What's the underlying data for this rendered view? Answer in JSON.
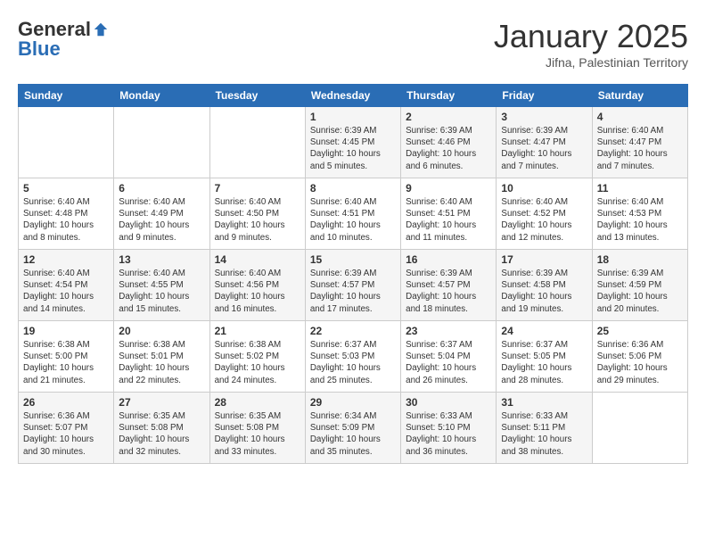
{
  "header": {
    "logo_general": "General",
    "logo_blue": "Blue",
    "month_title": "January 2025",
    "subtitle": "Jifna, Palestinian Territory"
  },
  "weekdays": [
    "Sunday",
    "Monday",
    "Tuesday",
    "Wednesday",
    "Thursday",
    "Friday",
    "Saturday"
  ],
  "weeks": [
    [
      {
        "day": "",
        "info": ""
      },
      {
        "day": "",
        "info": ""
      },
      {
        "day": "",
        "info": ""
      },
      {
        "day": "1",
        "info": "Sunrise: 6:39 AM\nSunset: 4:45 PM\nDaylight: 10 hours\nand 5 minutes."
      },
      {
        "day": "2",
        "info": "Sunrise: 6:39 AM\nSunset: 4:46 PM\nDaylight: 10 hours\nand 6 minutes."
      },
      {
        "day": "3",
        "info": "Sunrise: 6:39 AM\nSunset: 4:47 PM\nDaylight: 10 hours\nand 7 minutes."
      },
      {
        "day": "4",
        "info": "Sunrise: 6:40 AM\nSunset: 4:47 PM\nDaylight: 10 hours\nand 7 minutes."
      }
    ],
    [
      {
        "day": "5",
        "info": "Sunrise: 6:40 AM\nSunset: 4:48 PM\nDaylight: 10 hours\nand 8 minutes."
      },
      {
        "day": "6",
        "info": "Sunrise: 6:40 AM\nSunset: 4:49 PM\nDaylight: 10 hours\nand 9 minutes."
      },
      {
        "day": "7",
        "info": "Sunrise: 6:40 AM\nSunset: 4:50 PM\nDaylight: 10 hours\nand 9 minutes."
      },
      {
        "day": "8",
        "info": "Sunrise: 6:40 AM\nSunset: 4:51 PM\nDaylight: 10 hours\nand 10 minutes."
      },
      {
        "day": "9",
        "info": "Sunrise: 6:40 AM\nSunset: 4:51 PM\nDaylight: 10 hours\nand 11 minutes."
      },
      {
        "day": "10",
        "info": "Sunrise: 6:40 AM\nSunset: 4:52 PM\nDaylight: 10 hours\nand 12 minutes."
      },
      {
        "day": "11",
        "info": "Sunrise: 6:40 AM\nSunset: 4:53 PM\nDaylight: 10 hours\nand 13 minutes."
      }
    ],
    [
      {
        "day": "12",
        "info": "Sunrise: 6:40 AM\nSunset: 4:54 PM\nDaylight: 10 hours\nand 14 minutes."
      },
      {
        "day": "13",
        "info": "Sunrise: 6:40 AM\nSunset: 4:55 PM\nDaylight: 10 hours\nand 15 minutes."
      },
      {
        "day": "14",
        "info": "Sunrise: 6:40 AM\nSunset: 4:56 PM\nDaylight: 10 hours\nand 16 minutes."
      },
      {
        "day": "15",
        "info": "Sunrise: 6:39 AM\nSunset: 4:57 PM\nDaylight: 10 hours\nand 17 minutes."
      },
      {
        "day": "16",
        "info": "Sunrise: 6:39 AM\nSunset: 4:57 PM\nDaylight: 10 hours\nand 18 minutes."
      },
      {
        "day": "17",
        "info": "Sunrise: 6:39 AM\nSunset: 4:58 PM\nDaylight: 10 hours\nand 19 minutes."
      },
      {
        "day": "18",
        "info": "Sunrise: 6:39 AM\nSunset: 4:59 PM\nDaylight: 10 hours\nand 20 minutes."
      }
    ],
    [
      {
        "day": "19",
        "info": "Sunrise: 6:38 AM\nSunset: 5:00 PM\nDaylight: 10 hours\nand 21 minutes."
      },
      {
        "day": "20",
        "info": "Sunrise: 6:38 AM\nSunset: 5:01 PM\nDaylight: 10 hours\nand 22 minutes."
      },
      {
        "day": "21",
        "info": "Sunrise: 6:38 AM\nSunset: 5:02 PM\nDaylight: 10 hours\nand 24 minutes."
      },
      {
        "day": "22",
        "info": "Sunrise: 6:37 AM\nSunset: 5:03 PM\nDaylight: 10 hours\nand 25 minutes."
      },
      {
        "day": "23",
        "info": "Sunrise: 6:37 AM\nSunset: 5:04 PM\nDaylight: 10 hours\nand 26 minutes."
      },
      {
        "day": "24",
        "info": "Sunrise: 6:37 AM\nSunset: 5:05 PM\nDaylight: 10 hours\nand 28 minutes."
      },
      {
        "day": "25",
        "info": "Sunrise: 6:36 AM\nSunset: 5:06 PM\nDaylight: 10 hours\nand 29 minutes."
      }
    ],
    [
      {
        "day": "26",
        "info": "Sunrise: 6:36 AM\nSunset: 5:07 PM\nDaylight: 10 hours\nand 30 minutes."
      },
      {
        "day": "27",
        "info": "Sunrise: 6:35 AM\nSunset: 5:08 PM\nDaylight: 10 hours\nand 32 minutes."
      },
      {
        "day": "28",
        "info": "Sunrise: 6:35 AM\nSunset: 5:08 PM\nDaylight: 10 hours\nand 33 minutes."
      },
      {
        "day": "29",
        "info": "Sunrise: 6:34 AM\nSunset: 5:09 PM\nDaylight: 10 hours\nand 35 minutes."
      },
      {
        "day": "30",
        "info": "Sunrise: 6:33 AM\nSunset: 5:10 PM\nDaylight: 10 hours\nand 36 minutes."
      },
      {
        "day": "31",
        "info": "Sunrise: 6:33 AM\nSunset: 5:11 PM\nDaylight: 10 hours\nand 38 minutes."
      },
      {
        "day": "",
        "info": ""
      }
    ]
  ]
}
